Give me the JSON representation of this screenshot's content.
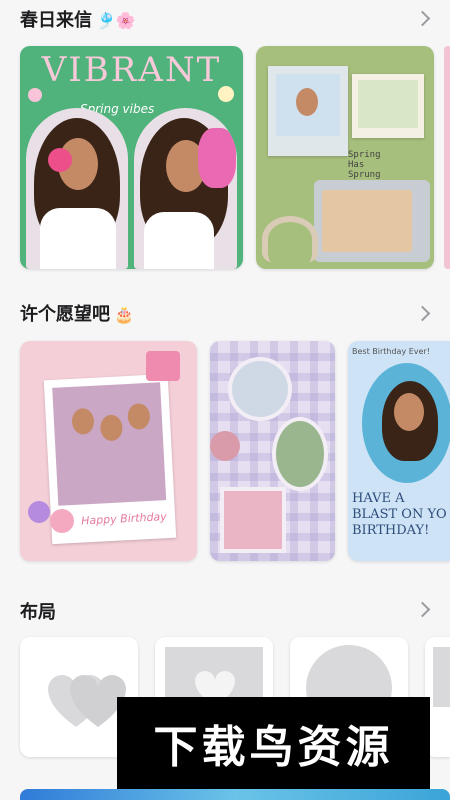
{
  "sections": {
    "spring": {
      "title": "春日来信",
      "emoji": "🎐🌸"
    },
    "wish": {
      "title": "许个愿望吧",
      "emoji": "🎂"
    },
    "layout": {
      "title": "布局"
    }
  },
  "cards": {
    "vibrant": {
      "title": "VIBRANT",
      "subtitle": "Spring vibes"
    },
    "scrapbook": {
      "tag": "Spring Has Sprung"
    },
    "party": {
      "caption": "Happy Birthday"
    },
    "blast": {
      "header": "Best Birthday Ever!",
      "line1": "HAVE A",
      "line2": "BLAST ON YO",
      "line3": "BIRTHDAY!"
    }
  },
  "watermark": "下载鸟资源",
  "colors": {
    "vibrant_bg": "#4fb37b",
    "scrap_bg": "#a7bf7d",
    "party_bg": "#f5cfd8",
    "plaid_bg": "#e6dff1",
    "blast_bg": "#cfe3f6"
  }
}
